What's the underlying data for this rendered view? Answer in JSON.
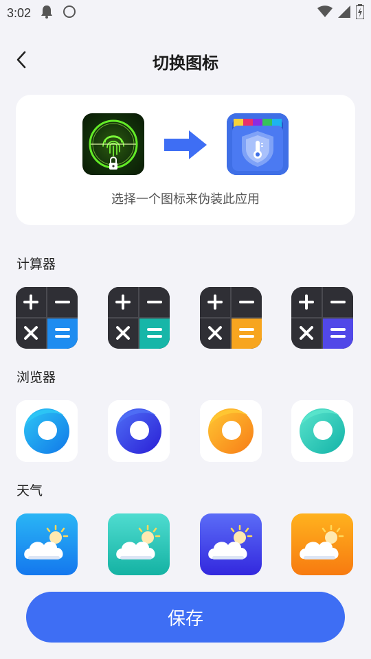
{
  "status_bar": {
    "time": "3:02"
  },
  "header": {
    "title": "切换图标"
  },
  "preview": {
    "caption": "选择一个图标来伪装此应用"
  },
  "sections": {
    "calculator": "计算器",
    "browser": "浏览器",
    "weather": "天气"
  },
  "calculator_icons": [
    {
      "accent": "#1e8cf0"
    },
    {
      "accent": "#17b6a8"
    },
    {
      "accent": "#f7a51f"
    },
    {
      "accent": "#5148e8"
    }
  ],
  "browser_icons": [
    {
      "colors": [
        "#2ec7f5",
        "#1177e8"
      ]
    },
    {
      "colors": [
        "#4f6ff5",
        "#2a1fd6"
      ]
    },
    {
      "colors": [
        "#ffc833",
        "#f77c17"
      ]
    },
    {
      "colors": [
        "#5ae4cc",
        "#13b3a8"
      ]
    }
  ],
  "weather_icons": [
    {
      "colors": [
        "#2ab5f5",
        "#1477ee"
      ]
    },
    {
      "colors": [
        "#4fdcd0",
        "#14b2a3"
      ]
    },
    {
      "colors": [
        "#5b6cf7",
        "#3328de"
      ]
    },
    {
      "colors": [
        "#ffb21e",
        "#f77a10"
      ]
    }
  ],
  "save_button": {
    "label": "保存"
  },
  "colors": {
    "background": "#f3f3f8",
    "primary": "#3e6ef4"
  }
}
